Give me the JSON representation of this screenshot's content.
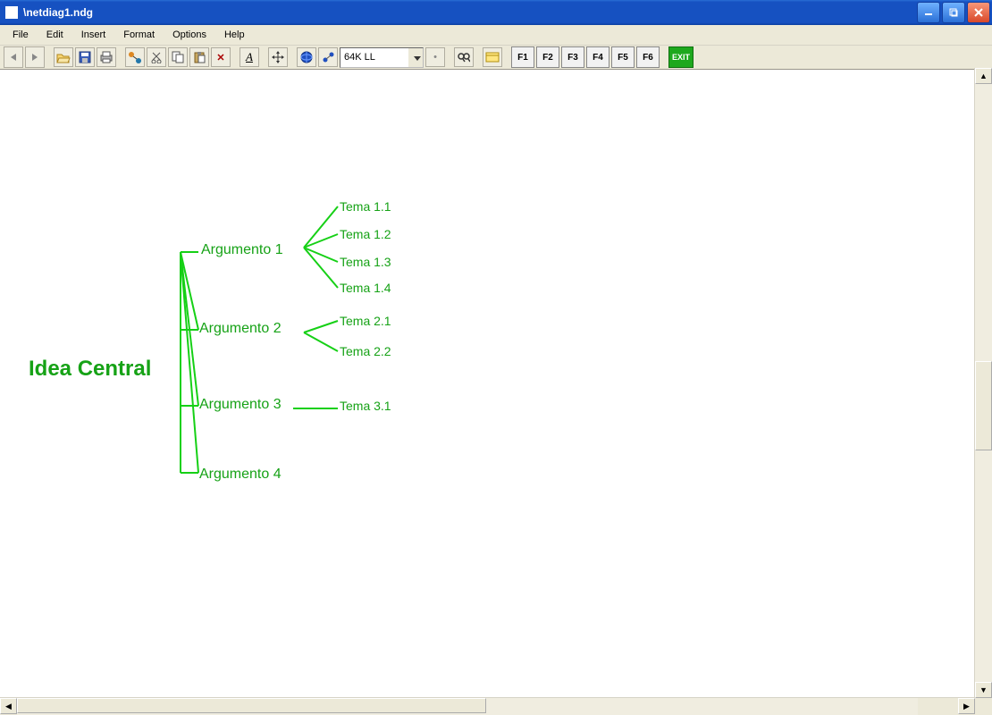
{
  "window": {
    "title": "\\netdiag1.ndg"
  },
  "menu": {
    "items": [
      "File",
      "Edit",
      "Insert",
      "Format",
      "Options",
      "Help"
    ]
  },
  "toolbar": {
    "zoom_value": "64K LL",
    "fkeys": [
      "F1",
      "F2",
      "F3",
      "F4",
      "F5",
      "F6"
    ],
    "exit_label": "EXIT"
  },
  "diagram": {
    "root": "Idea Central",
    "arguments": [
      {
        "label": "Argumento 1",
        "themes": [
          "Tema 1.1",
          "Tema 1.2",
          "Tema 1.3",
          "Tema 1.4"
        ]
      },
      {
        "label": "Argumento 2",
        "themes": [
          "Tema 2.1",
          "Tema 2.2"
        ]
      },
      {
        "label": "Argumento 3",
        "themes": [
          "Tema 3.1"
        ]
      },
      {
        "label": "Argumento 4",
        "themes": []
      }
    ]
  }
}
